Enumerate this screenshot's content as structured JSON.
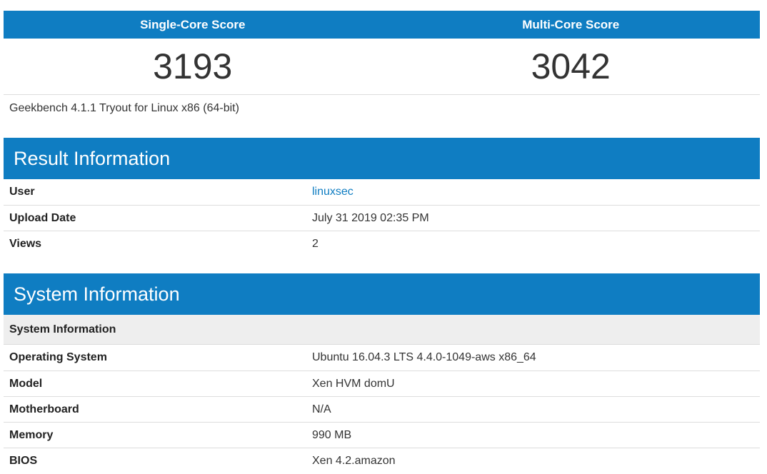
{
  "scores": {
    "single_label": "Single-Core Score",
    "multi_label": "Multi-Core Score",
    "single_value": "3193",
    "multi_value": "3042"
  },
  "version_text": "Geekbench 4.1.1 Tryout for Linux x86 (64-bit)",
  "result_info": {
    "title": "Result Information",
    "rows": [
      {
        "label": "User",
        "value": "linuxsec",
        "link": true
      },
      {
        "label": "Upload Date",
        "value": "July 31 2019 02:35 PM"
      },
      {
        "label": "Views",
        "value": "2"
      }
    ]
  },
  "system_info": {
    "title": "System Information",
    "subheader": "System Information",
    "rows": [
      {
        "label": "Operating System",
        "value": "Ubuntu 16.04.3 LTS 4.4.0-1049-aws x86_64"
      },
      {
        "label": "Model",
        "value": "Xen HVM domU"
      },
      {
        "label": "Motherboard",
        "value": "N/A"
      },
      {
        "label": "Memory",
        "value": "990 MB"
      },
      {
        "label": "BIOS",
        "value": "Xen 4.2.amazon"
      }
    ]
  },
  "colors": {
    "accent": "#0f7dc2",
    "subheader_bg": "#eeeeee",
    "divider": "#dddddd"
  }
}
